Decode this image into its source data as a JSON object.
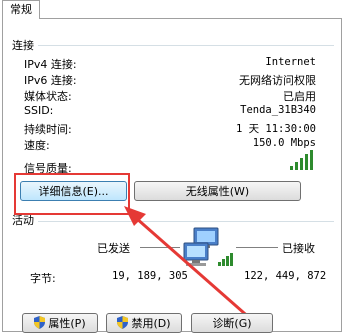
{
  "tab": {
    "label": "常规"
  },
  "connection": {
    "title": "连接",
    "rows": [
      {
        "label": "IPv4 连接:",
        "value": "Internet"
      },
      {
        "label": "IPv6 连接:",
        "value": "无网络访问权限"
      },
      {
        "label": "媒体状态:",
        "value": "已启用"
      },
      {
        "label": "SSID:",
        "value": "Tenda_31B340"
      },
      {
        "label": "持续时间:",
        "value": "1 天 11:30:00"
      },
      {
        "label": "速度:",
        "value": "150.0 Mbps"
      }
    ],
    "signal_label": "信号质量:",
    "signal_bars_lit": 5,
    "signal_bars_total": 5,
    "details_button": "详细信息(E)...",
    "wireless_button": "无线属性(W)"
  },
  "activity": {
    "title": "活动",
    "sent_label": "已发送",
    "received_label": "已接收",
    "bytes_label": "字节:",
    "bytes_sent": "19, 189, 305",
    "bytes_received": "122, 449, 872"
  },
  "footer": {
    "properties_button": "属性(P)",
    "disable_button": "禁用(D)",
    "diagnose_button": "诊断(G)"
  },
  "colors": {
    "highlight": "#e53935",
    "signal": "#2e8b2e"
  }
}
